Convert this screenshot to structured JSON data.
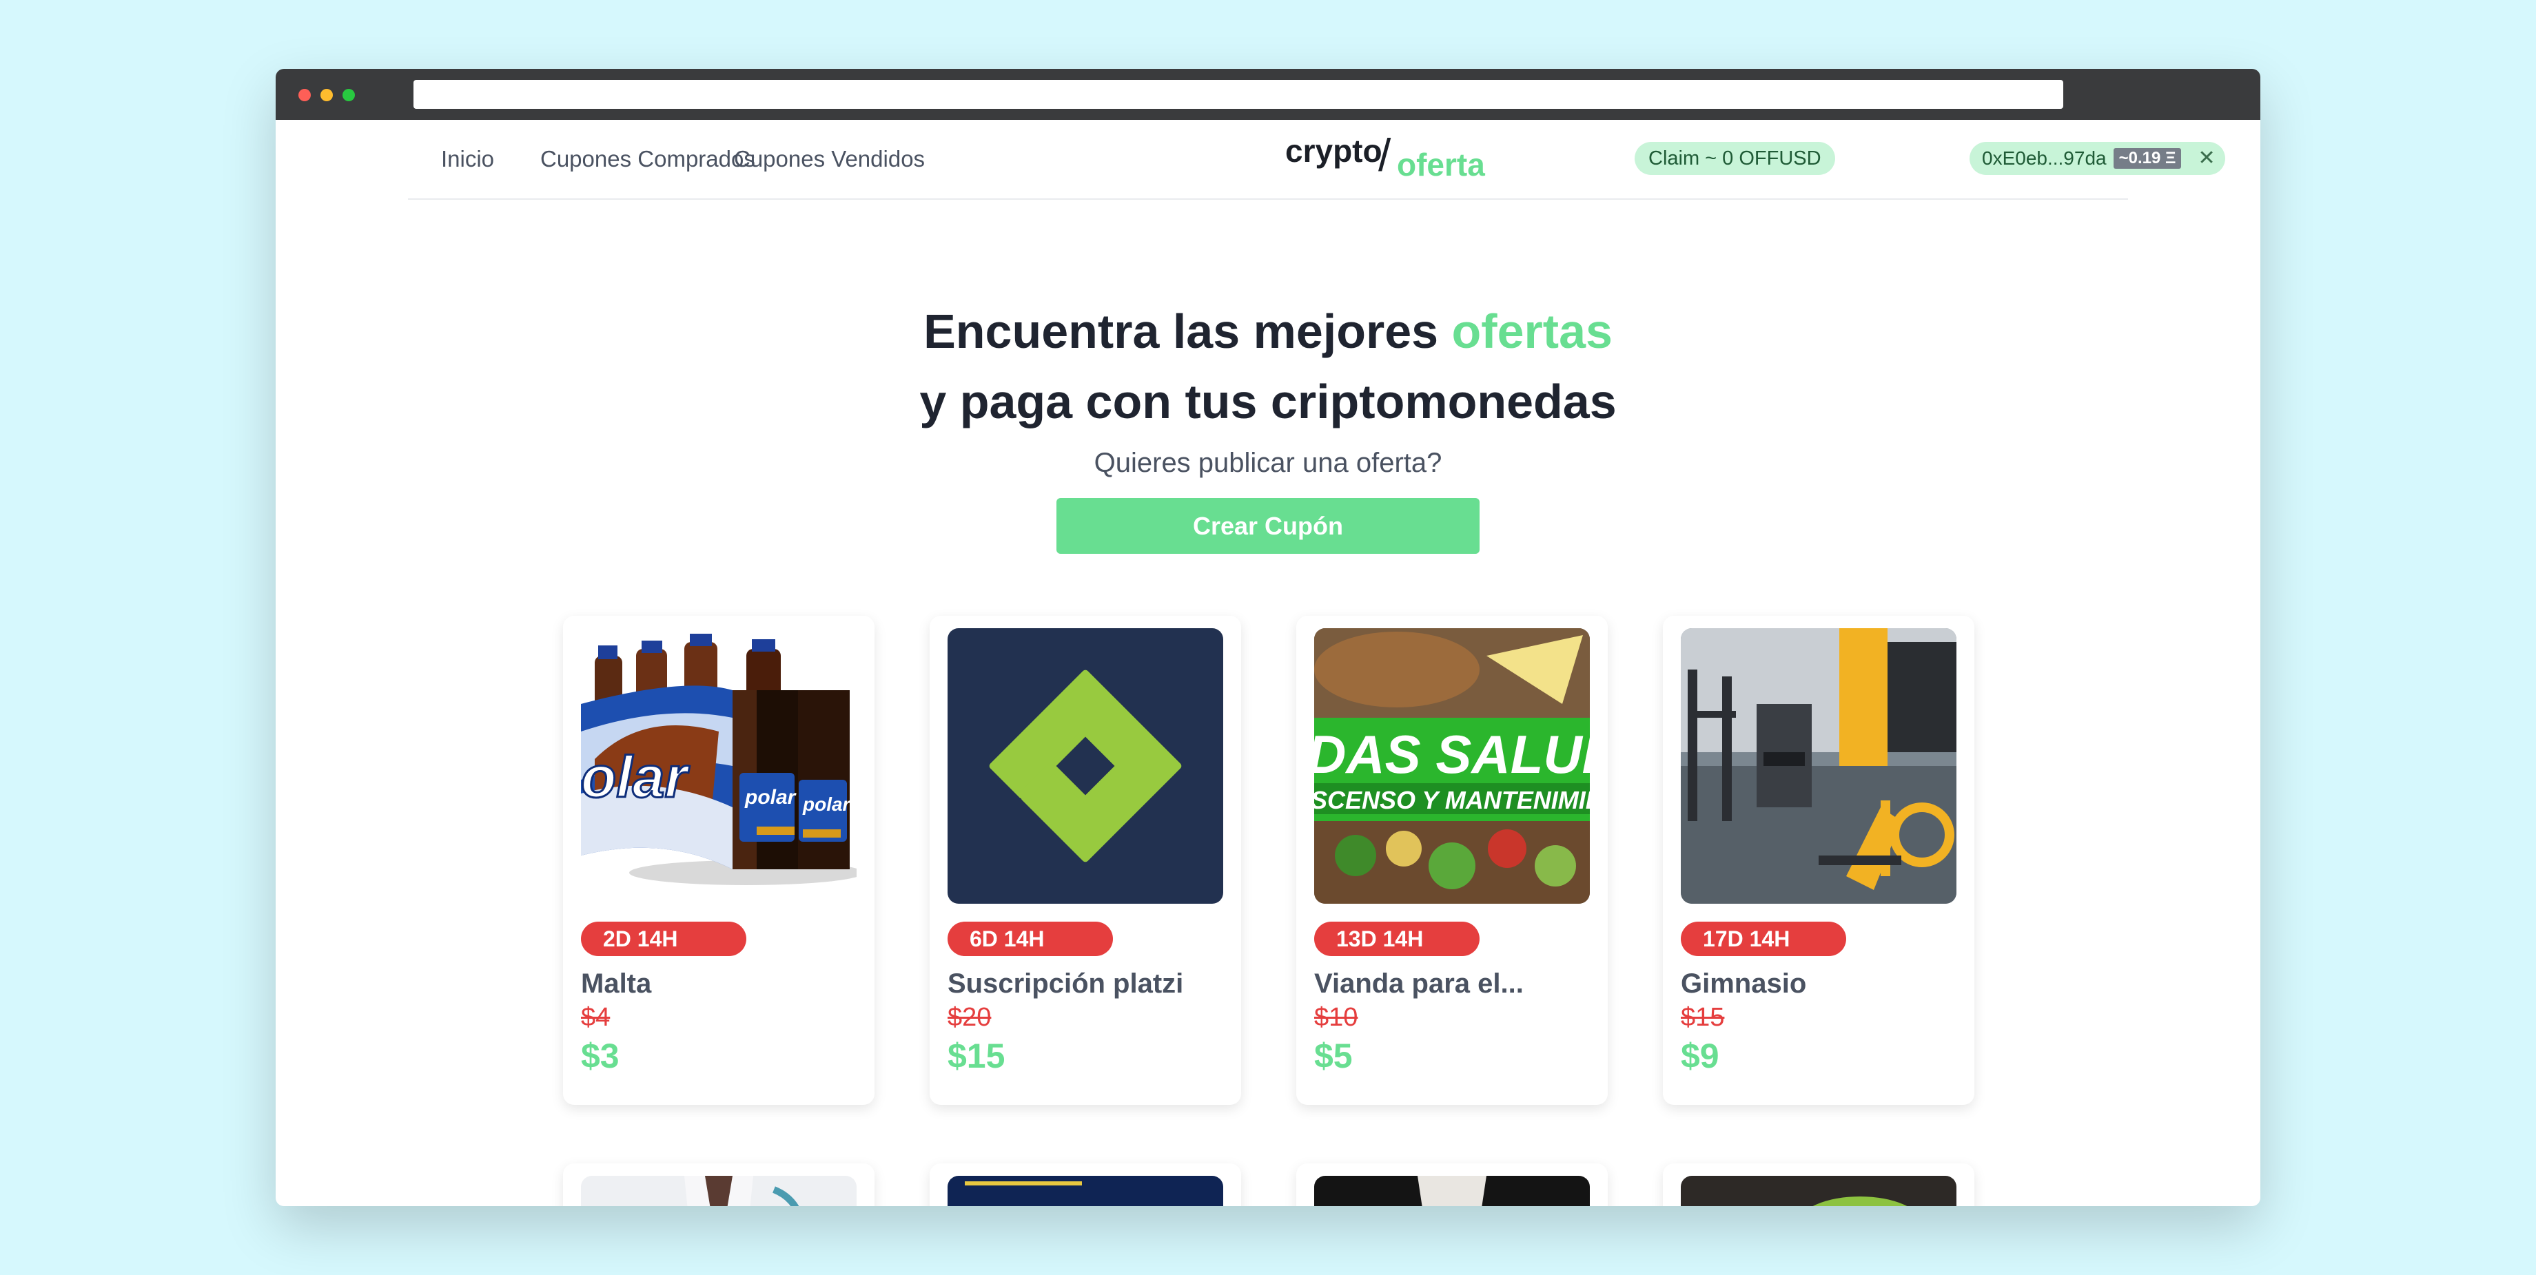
{
  "nav": {
    "links": [
      "Inicio",
      "Cupones Comprados",
      "Cupones Vendidos"
    ],
    "logo": {
      "part1": "crypto",
      "slash": "/",
      "part2": "oferta"
    },
    "claim_label": "Claim ~ 0 OFFUSD",
    "wallet": {
      "address": "0xE0eb...97da",
      "balance": "~0.19 Ξ",
      "close": "✕"
    }
  },
  "hero": {
    "title_line1_prefix": "Encuentra las mejores ",
    "title_line1_accent": "ofertas",
    "title_line2": "y paga con tus criptomonedas",
    "subtitle": "Quieres publicar una oferta?",
    "cta": "Crear Cupón"
  },
  "cards": [
    {
      "timer": "2D 14H",
      "title": "Malta",
      "old_price": "$4",
      "price": "$3",
      "image": "malta-polar-bottles"
    },
    {
      "timer": "6D 14H",
      "title": "Suscripción platzi",
      "old_price": "$20",
      "price": "$15",
      "image": "platzi-logo"
    },
    {
      "timer": "13D 14H",
      "title": "Vianda para el...",
      "old_price": "$10",
      "price": "$5",
      "image": "healthy-food",
      "image_text_1": "DAS SALUDABL",
      "image_text_2": "SCENSO Y MANTENIMIENTO-FIT"
    },
    {
      "timer": "17D 14H",
      "title": "Gimnasio",
      "old_price": "$15",
      "price": "$9",
      "image": "gym-equipment"
    }
  ],
  "colors": {
    "accent": "#68de91",
    "danger": "#e53e3e",
    "text": "#1f2430"
  }
}
